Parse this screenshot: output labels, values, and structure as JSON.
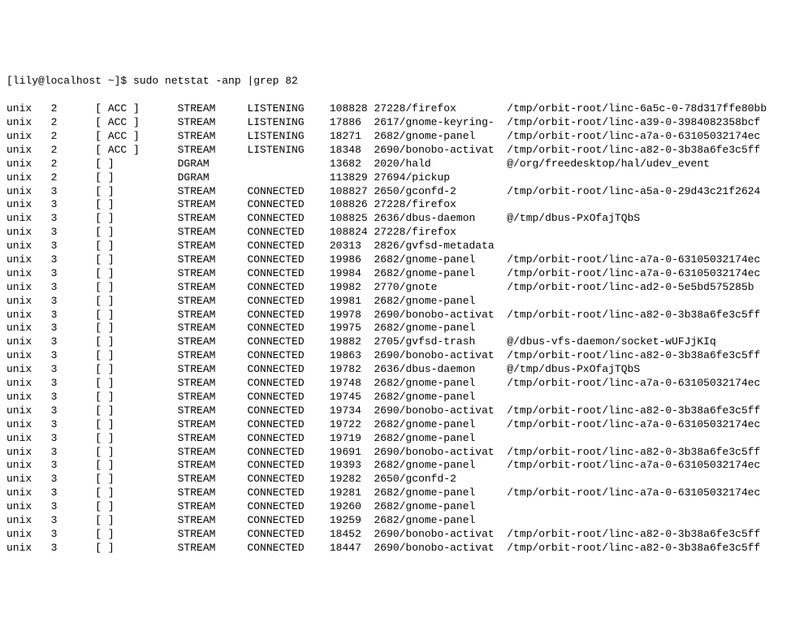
{
  "prompt": "[lily@localhost ~]$ sudo netstat -anp |grep 82",
  "rows": [
    {
      "proto": "unix",
      "refcnt": "2",
      "flags": "[ ACC ]",
      "type": "STREAM",
      "state": "LISTENING",
      "inode": "108828",
      "pidprog": "27228/firefox",
      "path": "/tmp/orbit-root/linc-6a5c-0-78d317ffe80bb"
    },
    {
      "proto": "unix",
      "refcnt": "2",
      "flags": "[ ACC ]",
      "type": "STREAM",
      "state": "LISTENING",
      "inode": "17886",
      "pidprog": "2617/gnome-keyring-",
      "path": "/tmp/orbit-root/linc-a39-0-3984082358bcf"
    },
    {
      "proto": "unix",
      "refcnt": "2",
      "flags": "[ ACC ]",
      "type": "STREAM",
      "state": "LISTENING",
      "inode": "18271",
      "pidprog": "2682/gnome-panel",
      "path": "/tmp/orbit-root/linc-a7a-0-63105032174ec"
    },
    {
      "proto": "unix",
      "refcnt": "2",
      "flags": "[ ACC ]",
      "type": "STREAM",
      "state": "LISTENING",
      "inode": "18348",
      "pidprog": "2690/bonobo-activat",
      "path": "/tmp/orbit-root/linc-a82-0-3b38a6fe3c5ff"
    },
    {
      "proto": "unix",
      "refcnt": "2",
      "flags": "[ ]",
      "type": "DGRAM",
      "state": "",
      "inode": "13682",
      "pidprog": "2020/hald",
      "path": "@/org/freedesktop/hal/udev_event"
    },
    {
      "proto": "unix",
      "refcnt": "2",
      "flags": "[ ]",
      "type": "DGRAM",
      "state": "",
      "inode": "113829",
      "pidprog": "27694/pickup",
      "path": ""
    },
    {
      "proto": "unix",
      "refcnt": "3",
      "flags": "[ ]",
      "type": "STREAM",
      "state": "CONNECTED",
      "inode": "108827",
      "pidprog": "2650/gconfd-2",
      "path": "/tmp/orbit-root/linc-a5a-0-29d43c21f2624"
    },
    {
      "proto": "unix",
      "refcnt": "3",
      "flags": "[ ]",
      "type": "STREAM",
      "state": "CONNECTED",
      "inode": "108826",
      "pidprog": "27228/firefox",
      "path": ""
    },
    {
      "proto": "unix",
      "refcnt": "3",
      "flags": "[ ]",
      "type": "STREAM",
      "state": "CONNECTED",
      "inode": "108825",
      "pidprog": "2636/dbus-daemon",
      "path": "@/tmp/dbus-PxOfajTQbS"
    },
    {
      "proto": "unix",
      "refcnt": "3",
      "flags": "[ ]",
      "type": "STREAM",
      "state": "CONNECTED",
      "inode": "108824",
      "pidprog": "27228/firefox",
      "path": ""
    },
    {
      "proto": "unix",
      "refcnt": "3",
      "flags": "[ ]",
      "type": "STREAM",
      "state": "CONNECTED",
      "inode": "20313",
      "pidprog": "2826/gvfsd-metadata",
      "path": ""
    },
    {
      "proto": "unix",
      "refcnt": "3",
      "flags": "[ ]",
      "type": "STREAM",
      "state": "CONNECTED",
      "inode": "19986",
      "pidprog": "2682/gnome-panel",
      "path": "/tmp/orbit-root/linc-a7a-0-63105032174ec"
    },
    {
      "proto": "unix",
      "refcnt": "3",
      "flags": "[ ]",
      "type": "STREAM",
      "state": "CONNECTED",
      "inode": "19984",
      "pidprog": "2682/gnome-panel",
      "path": "/tmp/orbit-root/linc-a7a-0-63105032174ec"
    },
    {
      "proto": "unix",
      "refcnt": "3",
      "flags": "[ ]",
      "type": "STREAM",
      "state": "CONNECTED",
      "inode": "19982",
      "pidprog": "2770/gnote",
      "path": "/tmp/orbit-root/linc-ad2-0-5e5bd575285b"
    },
    {
      "proto": "unix",
      "refcnt": "3",
      "flags": "[ ]",
      "type": "STREAM",
      "state": "CONNECTED",
      "inode": "19981",
      "pidprog": "2682/gnome-panel",
      "path": ""
    },
    {
      "proto": "unix",
      "refcnt": "3",
      "flags": "[ ]",
      "type": "STREAM",
      "state": "CONNECTED",
      "inode": "19978",
      "pidprog": "2690/bonobo-activat",
      "path": "/tmp/orbit-root/linc-a82-0-3b38a6fe3c5ff"
    },
    {
      "proto": "unix",
      "refcnt": "3",
      "flags": "[ ]",
      "type": "STREAM",
      "state": "CONNECTED",
      "inode": "19975",
      "pidprog": "2682/gnome-panel",
      "path": ""
    },
    {
      "proto": "unix",
      "refcnt": "3",
      "flags": "[ ]",
      "type": "STREAM",
      "state": "CONNECTED",
      "inode": "19882",
      "pidprog": "2705/gvfsd-trash",
      "path": "@/dbus-vfs-daemon/socket-wUFJjKIq"
    },
    {
      "proto": "unix",
      "refcnt": "3",
      "flags": "[ ]",
      "type": "STREAM",
      "state": "CONNECTED",
      "inode": "19863",
      "pidprog": "2690/bonobo-activat",
      "path": "/tmp/orbit-root/linc-a82-0-3b38a6fe3c5ff"
    },
    {
      "proto": "unix",
      "refcnt": "3",
      "flags": "[ ]",
      "type": "STREAM",
      "state": "CONNECTED",
      "inode": "19782",
      "pidprog": "2636/dbus-daemon",
      "path": "@/tmp/dbus-PxOfajTQbS"
    },
    {
      "proto": "unix",
      "refcnt": "3",
      "flags": "[ ]",
      "type": "STREAM",
      "state": "CONNECTED",
      "inode": "19748",
      "pidprog": "2682/gnome-panel",
      "path": "/tmp/orbit-root/linc-a7a-0-63105032174ec"
    },
    {
      "proto": "unix",
      "refcnt": "3",
      "flags": "[ ]",
      "type": "STREAM",
      "state": "CONNECTED",
      "inode": "19745",
      "pidprog": "2682/gnome-panel",
      "path": ""
    },
    {
      "proto": "unix",
      "refcnt": "3",
      "flags": "[ ]",
      "type": "STREAM",
      "state": "CONNECTED",
      "inode": "19734",
      "pidprog": "2690/bonobo-activat",
      "path": "/tmp/orbit-root/linc-a82-0-3b38a6fe3c5ff"
    },
    {
      "proto": "unix",
      "refcnt": "3",
      "flags": "[ ]",
      "type": "STREAM",
      "state": "CONNECTED",
      "inode": "19722",
      "pidprog": "2682/gnome-panel",
      "path": "/tmp/orbit-root/linc-a7a-0-63105032174ec"
    },
    {
      "proto": "unix",
      "refcnt": "3",
      "flags": "[ ]",
      "type": "STREAM",
      "state": "CONNECTED",
      "inode": "19719",
      "pidprog": "2682/gnome-panel",
      "path": ""
    },
    {
      "proto": "unix",
      "refcnt": "3",
      "flags": "[ ]",
      "type": "STREAM",
      "state": "CONNECTED",
      "inode": "19691",
      "pidprog": "2690/bonobo-activat",
      "path": "/tmp/orbit-root/linc-a82-0-3b38a6fe3c5ff"
    },
    {
      "proto": "unix",
      "refcnt": "3",
      "flags": "[ ]",
      "type": "STREAM",
      "state": "CONNECTED",
      "inode": "19393",
      "pidprog": "2682/gnome-panel",
      "path": "/tmp/orbit-root/linc-a7a-0-63105032174ec"
    },
    {
      "proto": "unix",
      "refcnt": "3",
      "flags": "[ ]",
      "type": "STREAM",
      "state": "CONNECTED",
      "inode": "19282",
      "pidprog": "2650/gconfd-2",
      "path": ""
    },
    {
      "proto": "unix",
      "refcnt": "3",
      "flags": "[ ]",
      "type": "STREAM",
      "state": "CONNECTED",
      "inode": "19281",
      "pidprog": "2682/gnome-panel",
      "path": "/tmp/orbit-root/linc-a7a-0-63105032174ec"
    },
    {
      "proto": "unix",
      "refcnt": "3",
      "flags": "[ ]",
      "type": "STREAM",
      "state": "CONNECTED",
      "inode": "19260",
      "pidprog": "2682/gnome-panel",
      "path": ""
    },
    {
      "proto": "unix",
      "refcnt": "3",
      "flags": "[ ]",
      "type": "STREAM",
      "state": "CONNECTED",
      "inode": "19259",
      "pidprog": "2682/gnome-panel",
      "path": ""
    },
    {
      "proto": "unix",
      "refcnt": "3",
      "flags": "[ ]",
      "type": "STREAM",
      "state": "CONNECTED",
      "inode": "18452",
      "pidprog": "2690/bonobo-activat",
      "path": "/tmp/orbit-root/linc-a82-0-3b38a6fe3c5ff"
    },
    {
      "proto": "unix",
      "refcnt": "3",
      "flags": "[ ]",
      "type": "STREAM",
      "state": "CONNECTED",
      "inode": "18447",
      "pidprog": "2690/bonobo-activat",
      "path": "/tmp/orbit-root/linc-a82-0-3b38a6fe3c5ff"
    }
  ]
}
